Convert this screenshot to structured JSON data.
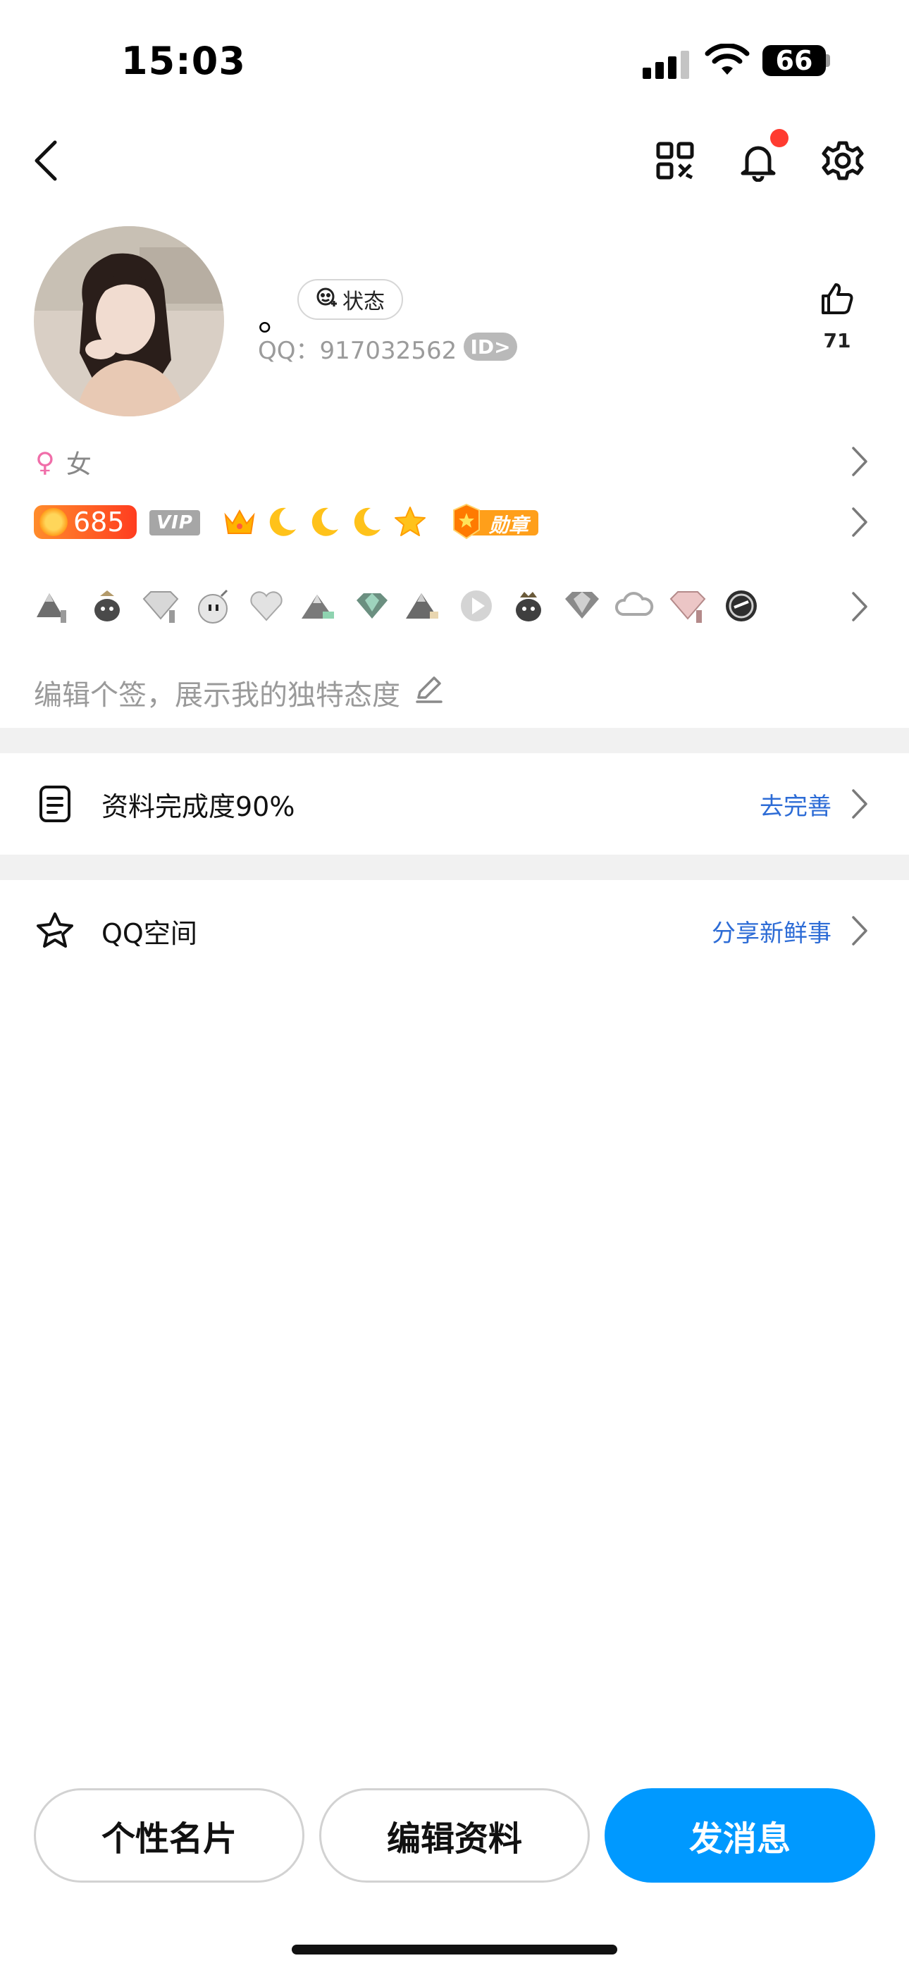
{
  "status_bar": {
    "time": "15:03",
    "battery": "66"
  },
  "profile": {
    "nickname": "。",
    "status_label": "状态",
    "qq_label": "QQ：917032562",
    "id_badge": "ID>",
    "likes": "71",
    "gender": "女",
    "level": "685",
    "vip": "VIP",
    "medal_label": "勋章",
    "signature": "编辑个签，展示我的独特态度"
  },
  "level_icons": [
    "crown-icon",
    "moon-icon",
    "moon-icon",
    "moon-icon",
    "star-icon"
  ],
  "badges": [
    "mountain-badge",
    "penguin-badge",
    "diamond-badge",
    "bomb-badge",
    "heart-badge",
    "mountain-badge",
    "gem-badge",
    "mountain-badge",
    "play-badge",
    "penguin-badge",
    "diamond-badge",
    "cloud-badge",
    "pink-diamond-badge",
    "cf-badge"
  ],
  "rows": {
    "completeness": {
      "label": "资料完成度90%",
      "action": "去完善"
    },
    "qzone": {
      "label": "QQ空间",
      "action": "分享新鲜事"
    }
  },
  "buttons": {
    "card": "个性名片",
    "edit": "编辑资料",
    "message": "发消息"
  },
  "colors": {
    "accent": "#0099ff",
    "link": "#2d6cd6",
    "notification": "#ff3b30"
  }
}
